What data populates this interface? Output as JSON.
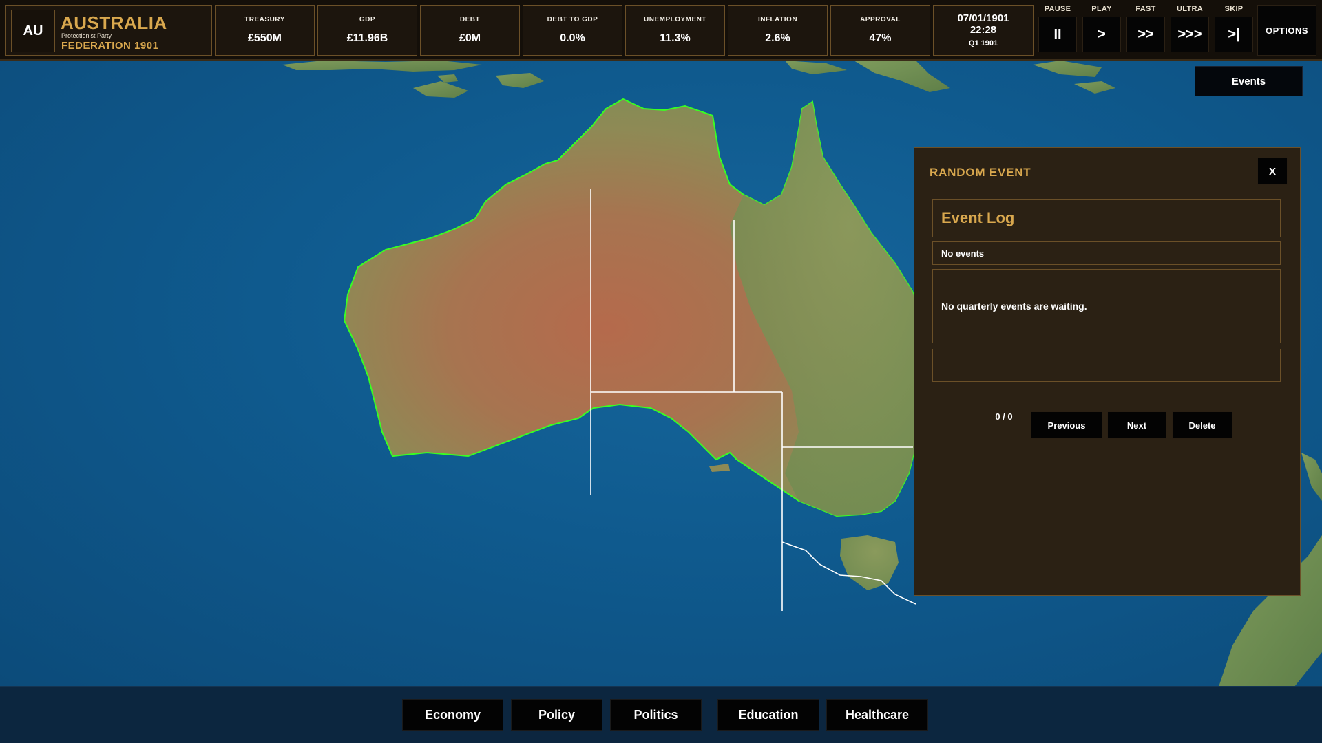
{
  "header": {
    "country_code": "AU",
    "country_name": "AUSTRALIA",
    "party": "Protectionist Party",
    "subtitle": "FEDERATION 1901",
    "stats": [
      {
        "label": "TREASURY",
        "value": "£550M"
      },
      {
        "label": "GDP",
        "value": "£11.96B"
      },
      {
        "label": "DEBT",
        "value": "£0M"
      },
      {
        "label": "DEBT TO GDP",
        "value": "0.0%"
      },
      {
        "label": "UNEMPLOYMENT",
        "value": "11.3%"
      },
      {
        "label": "INFLATION",
        "value": "2.6%"
      },
      {
        "label": "APPROVAL",
        "value": "47%"
      }
    ],
    "date": "07/01/1901",
    "time": "22:28",
    "quarter": "Q1 1901",
    "speed": [
      {
        "label": "PAUSE",
        "symbol": "II"
      },
      {
        "label": "PLAY",
        "symbol": ">"
      },
      {
        "label": "FAST",
        "symbol": ">>"
      },
      {
        "label": "ULTRA",
        "symbol": ">>>"
      },
      {
        "label": "SKIP",
        "symbol": ">|"
      }
    ],
    "options_label": "OPTIONS"
  },
  "events_button": "Events",
  "event_panel": {
    "title": "RANDOM EVENT",
    "close_label": "X",
    "log_title": "Event Log",
    "status": "No events",
    "body": "No quarterly events are waiting.",
    "pager": "0 / 0",
    "previous_label": "Previous",
    "next_label": "Next",
    "delete_label": "Delete"
  },
  "nav": [
    {
      "label": "Economy"
    },
    {
      "label": "Policy"
    },
    {
      "label": "Politics"
    },
    {
      "label": "Education"
    },
    {
      "label": "Healthcare"
    }
  ],
  "colors": {
    "accent_gold": "#d9a84e",
    "panel_bg": "#2b2114",
    "ocean": "#0f5689",
    "border_green": "#39ff22"
  }
}
